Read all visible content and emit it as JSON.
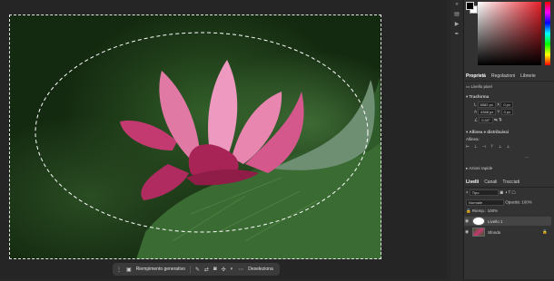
{
  "context_bar": {
    "generative_fill_label": "Riempimento generativo",
    "deselect_label": "Deseleziona"
  },
  "panels": {
    "tabs": [
      "Proprietà",
      "Regolazioni",
      "Librerie"
    ],
    "properties": {
      "layer_type": "Livello pixel",
      "transform_label": "Trasforma",
      "w": "6582 px",
      "h": "4388 px",
      "x": "0 px",
      "y": "0 px",
      "angle": "0,00°",
      "align_label": "Allinea e distribuisci",
      "align_sub": "Allinea:",
      "quick_actions": "Azioni rapide",
      "more": "..."
    },
    "layers_tabs": [
      "Livelli",
      "Canali",
      "Tracciati"
    ],
    "kind_label": "Tipo",
    "blend_mode": "Normale",
    "opacity_label": "Opacità:",
    "opacity": "100%",
    "fill_label": "Riemp.:",
    "fill": "100%",
    "layers": [
      {
        "name": "Livello 1",
        "selected": true
      },
      {
        "name": "Sfondo",
        "selected": false
      }
    ]
  }
}
